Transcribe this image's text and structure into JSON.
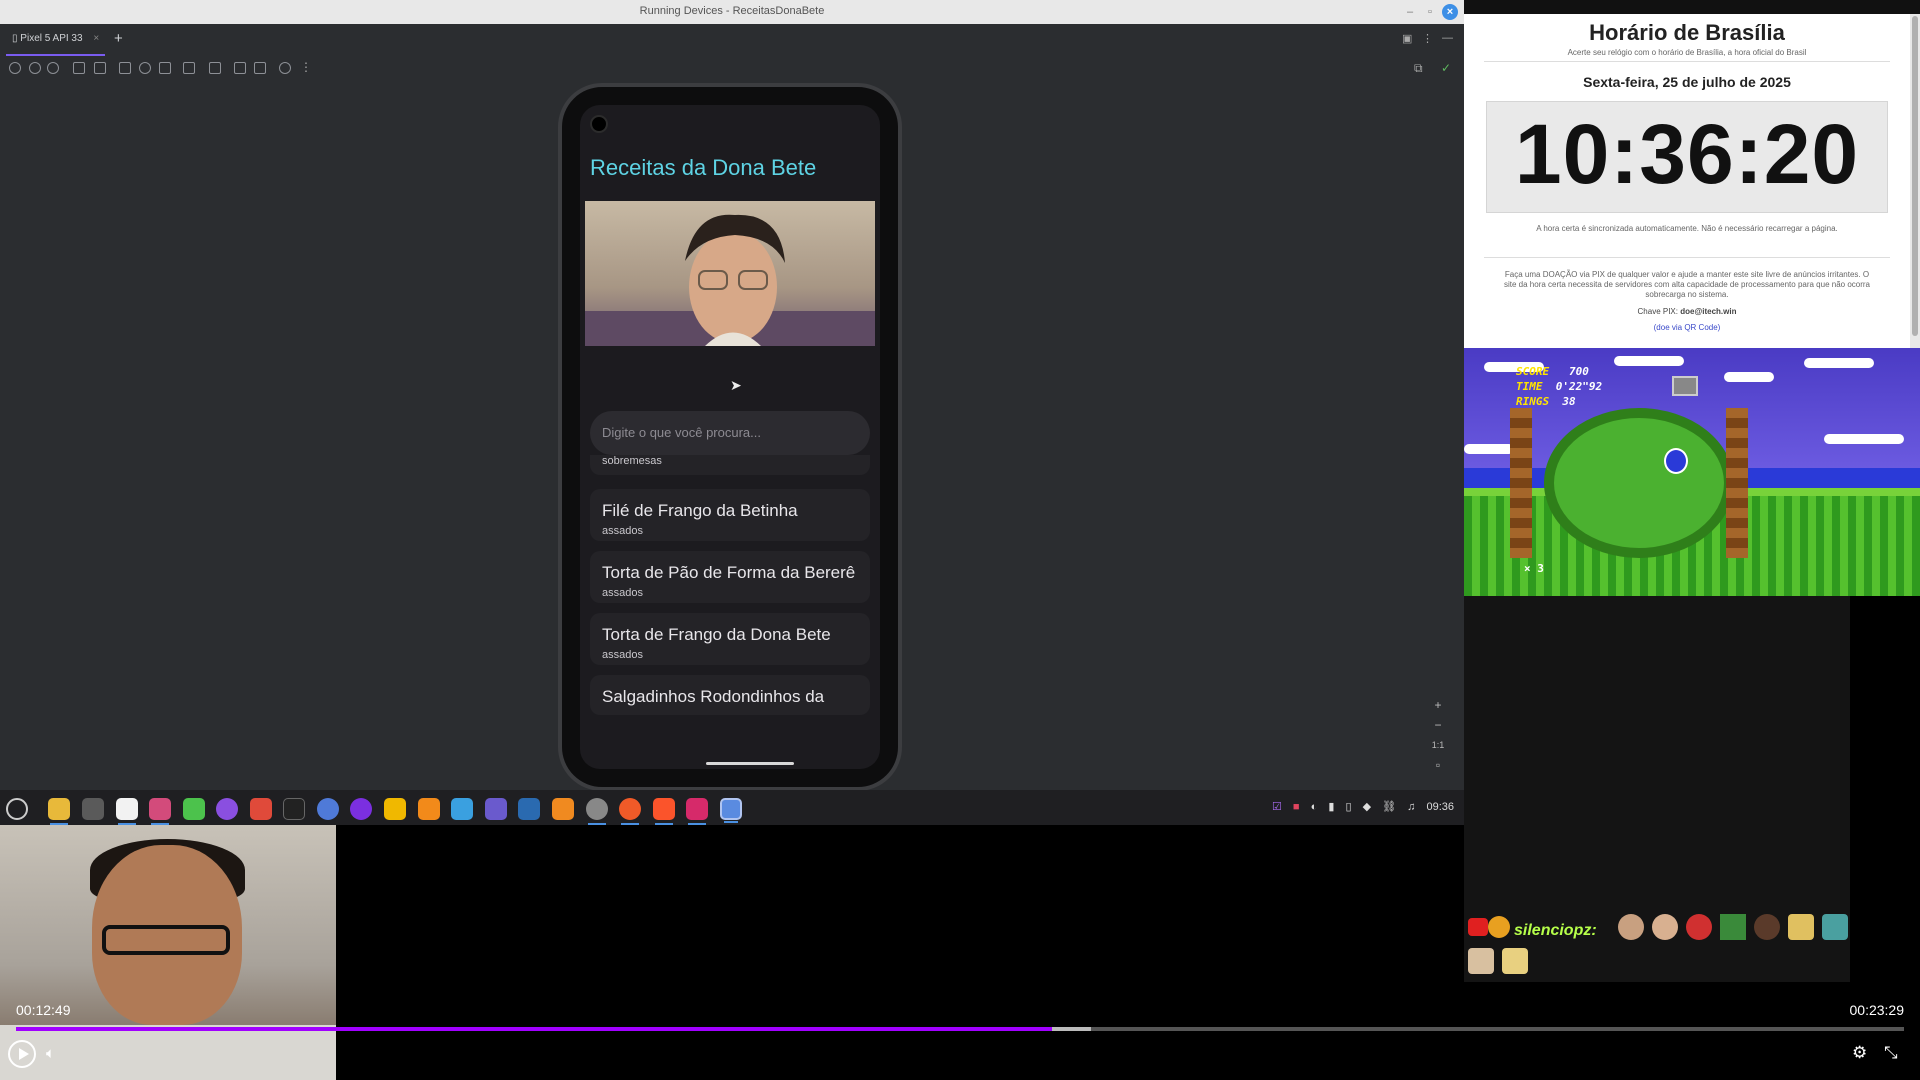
{
  "window": {
    "title": "Running Devices - ReceitasDonaBete"
  },
  "studio": {
    "device_tab": "Pixel 5 API 33",
    "zoom": {
      "plus": "+",
      "minus": "−",
      "one_to_one": "1:1"
    }
  },
  "app": {
    "title": "Receitas da Dona Bete",
    "search_placeholder": "Digite o que você procura...",
    "partial_category": "sobremesas",
    "recipes": [
      {
        "name": "Filé de Frango da Betinha",
        "category": "assados"
      },
      {
        "name": "Torta de Pão de Forma da Bererê",
        "category": "assados"
      },
      {
        "name": "Torta de Frango da Dona Bete",
        "category": "assados"
      },
      {
        "name": "Salgadinhos Rodondinhos da",
        "category": ""
      }
    ]
  },
  "taskbar": {
    "clock": "09:36"
  },
  "clock_site": {
    "title": "Horário de Brasília",
    "subtitle": "Acerte seu relógio com o horário de Brasília, a hora oficial do Brasil",
    "date": "Sexta-feira, 25 de julho de 2025",
    "time": "10:36:20",
    "note": "A hora certa é sincronizada automaticamente. Não é necessário recarregar a página.",
    "donate": "Faça uma DOAÇÃO via PIX de qualquer valor e ajude a manter este site livre de anúncios irritantes. O site da hora certa necessita de servidores com alta capacidade de processamento para que não ocorra sobrecarga no sistema.",
    "pix_label": "Chave PIX:",
    "pix_key": "doe@itech.win",
    "qr_link": "(doe via QR Code)"
  },
  "game": {
    "score_label": "SCORE",
    "score": "700",
    "time_label": "TIME",
    "time": "0'22\"92",
    "rings_label": "RINGS",
    "rings": "38",
    "lives": "× 3"
  },
  "chat": {
    "username": "silenciopz:"
  },
  "player": {
    "current_time": "00:12:49",
    "duration": "00:23:29",
    "progress": 0.5489,
    "buffered": 0.5693
  },
  "colors": {
    "accent": "#a100ff",
    "app_title": "#5ed3e4",
    "studio_bg": "#2b2d30"
  },
  "icons": {
    "play": "play-icon",
    "volume": "volume-icon",
    "settings": "gear-icon",
    "fullscreen": "exit-fullscreen-icon"
  }
}
